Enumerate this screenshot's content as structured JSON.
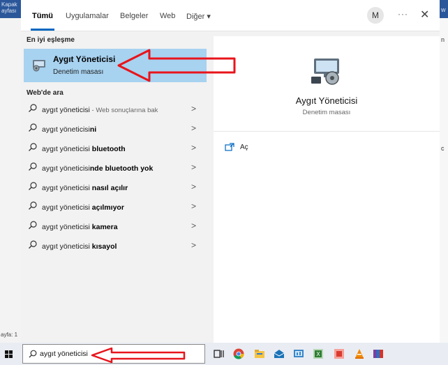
{
  "background": {
    "left_text_1": "Kapak",
    "left_text_2": "ayfası",
    "left_text_bottom": "ayfa: 1",
    "right_text_1": "w",
    "right_text_2": "n",
    "right_text_3": "c"
  },
  "tabs": {
    "items": [
      "Tümü",
      "Uygulamalar",
      "Belgeler",
      "Web",
      "Diğer ▾"
    ],
    "active": "Tümü"
  },
  "header": {
    "avatar_letter": "M",
    "more": "···",
    "close": "✕"
  },
  "best_match": {
    "section": "En iyi eşleşme",
    "title": "Aygıt Yöneticisi",
    "subtitle": "Denetim masası"
  },
  "web_search": {
    "section": "Web'de ara",
    "items": [
      {
        "base": "aygıt yöneticisi",
        "bold": "",
        "extra": " - Web sonuçlarına bak"
      },
      {
        "base": "aygıt yöneticisi",
        "bold": "ni",
        "extra": ""
      },
      {
        "base": "aygıt yöneticisi ",
        "bold": "bluetooth",
        "extra": ""
      },
      {
        "base": "aygıt yöneticisi",
        "bold": "nde bluetooth yok",
        "extra": ""
      },
      {
        "base": "aygıt yöneticisi ",
        "bold": "nasıl açılır",
        "extra": ""
      },
      {
        "base": "aygıt yöneticisi ",
        "bold": "açılmıyor",
        "extra": ""
      },
      {
        "base": "aygıt yöneticisi ",
        "bold": "kamera",
        "extra": ""
      },
      {
        "base": "aygıt yöneticisi ",
        "bold": "kısayol",
        "extra": ""
      }
    ],
    "chevron": ">"
  },
  "detail": {
    "title": "Aygıt Yöneticisi",
    "subtitle": "Denetim masası",
    "open_label": "Aç"
  },
  "taskbar": {
    "search_value": "aygıt yöneticisi",
    "icons": [
      "task-view-icon",
      "chrome-icon",
      "file-explorer-icon",
      "mail-icon",
      "control-panel-icon",
      "excel-icon",
      "app-icon",
      "vlc-icon",
      "winrar-icon"
    ]
  },
  "annotation_color": "#e8141b"
}
